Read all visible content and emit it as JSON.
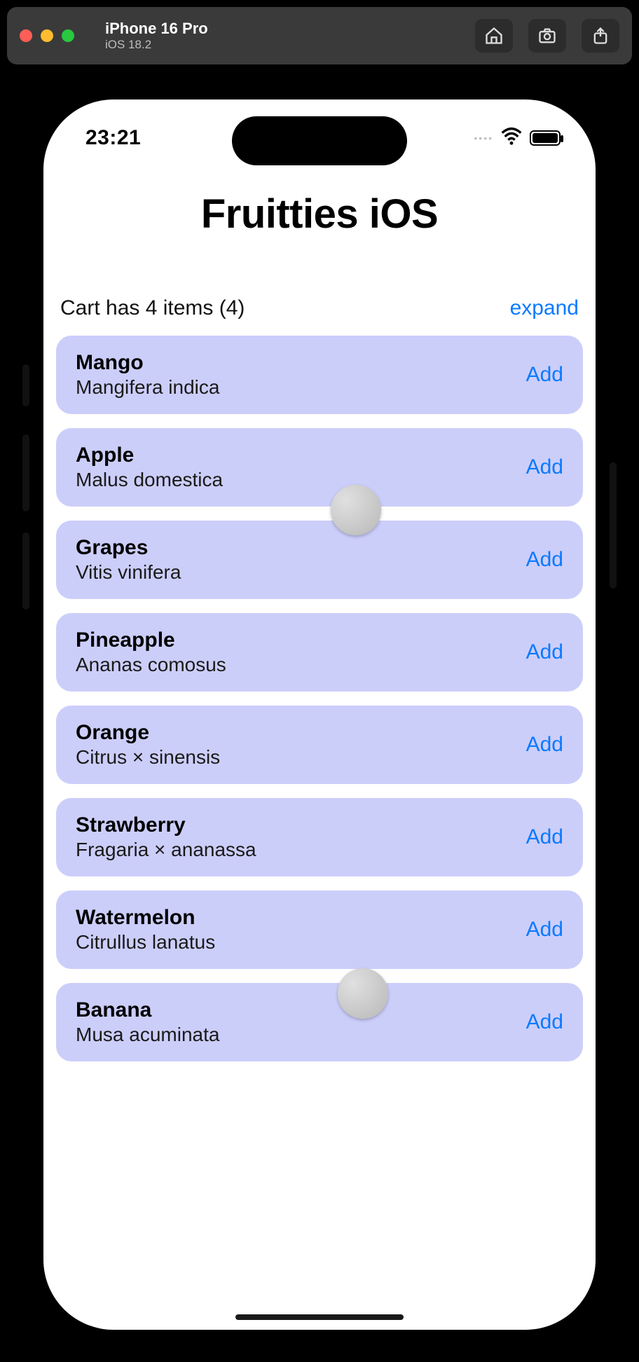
{
  "simulator": {
    "device": "iPhone 16 Pro",
    "os": "iOS 18.2"
  },
  "status": {
    "time": "23:21"
  },
  "app": {
    "title": "Fruitties iOS",
    "cart_label": "Cart has 4 items (4)",
    "expand_label": "expand",
    "add_label": "Add"
  },
  "fruits": [
    {
      "name": "Mango",
      "sub": "Mangifera indica"
    },
    {
      "name": "Apple",
      "sub": "Malus domestica"
    },
    {
      "name": "Grapes",
      "sub": "Vitis vinifera"
    },
    {
      "name": "Pineapple",
      "sub": "Ananas comosus"
    },
    {
      "name": "Orange",
      "sub": "Citrus × sinensis"
    },
    {
      "name": "Strawberry",
      "sub": "Fragaria × ananassa"
    },
    {
      "name": "Watermelon",
      "sub": "Citrullus lanatus"
    },
    {
      "name": "Banana",
      "sub": "Musa acuminata"
    }
  ]
}
